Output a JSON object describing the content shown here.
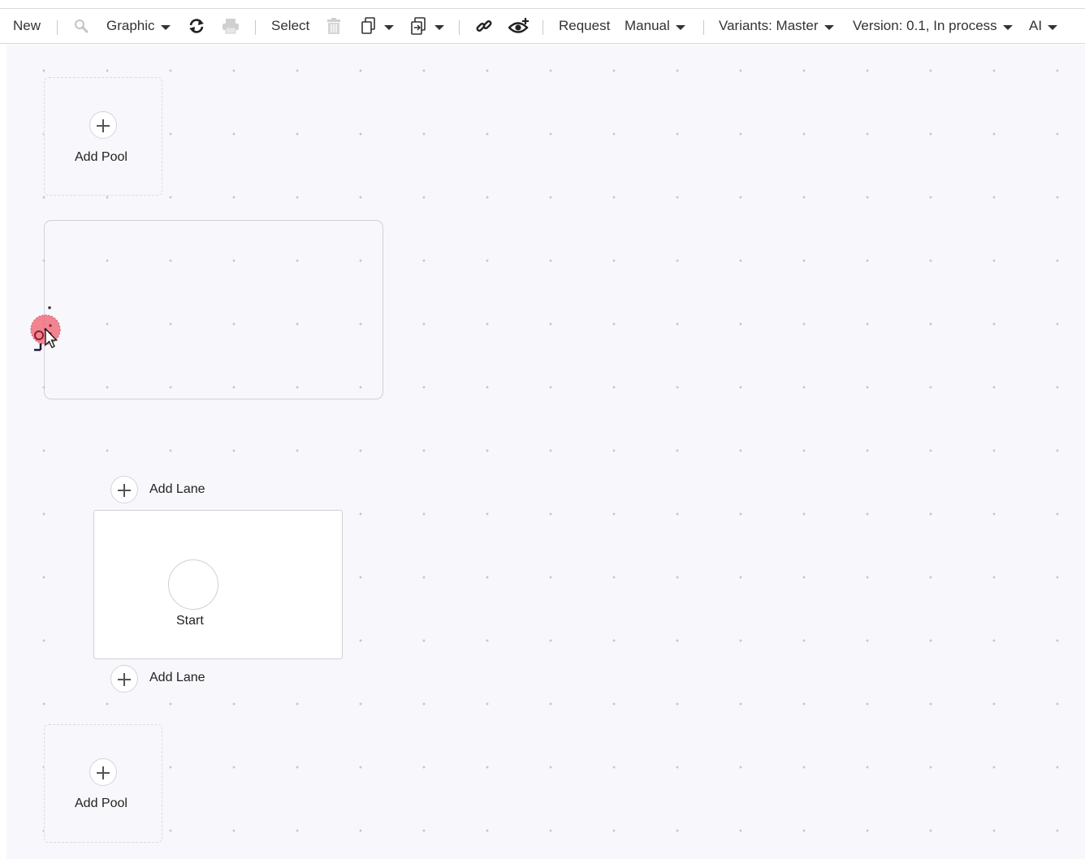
{
  "toolbar": {
    "new_label": "New",
    "graphic_label": "Graphic",
    "select_label": "Select",
    "request_label": "Request",
    "manual_label": "Manual",
    "variants_label": "Variants: Master",
    "version_label": "Version: 0.1, In process",
    "ai_label": "AI",
    "icons": [
      "search-icon",
      "refresh-icon",
      "print-icon",
      "trash-icon",
      "copy-icon",
      "paste-icon",
      "link-icon",
      "eye-plus-icon"
    ]
  },
  "canvas": {
    "add_pool_label": "Add Pool",
    "add_lane_label": "Add Lane",
    "start_label": "Start"
  },
  "colors": {
    "canvas_bg": "#f8f8fc",
    "grid_dot": "#c6c6cf",
    "cursor_marker": "#f0707e"
  }
}
